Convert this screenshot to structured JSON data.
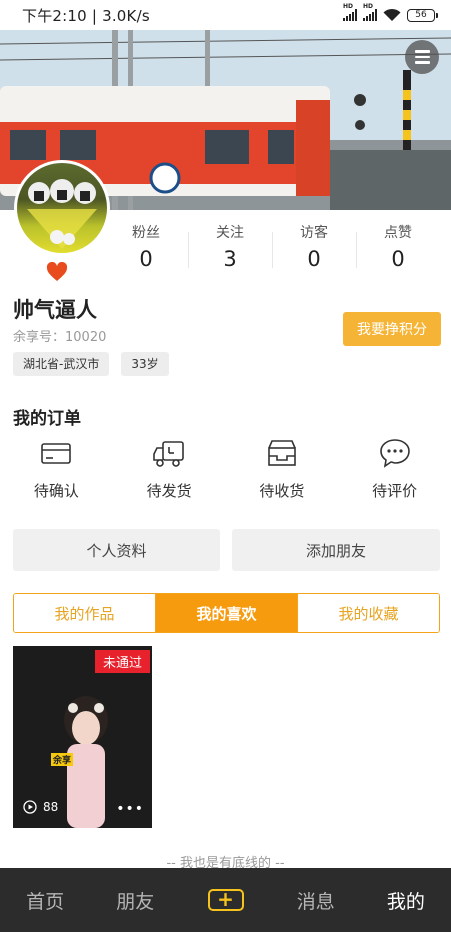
{
  "status_bar": {
    "time_speed": "下午2:10 | 3.0K/s",
    "battery": "56"
  },
  "user": {
    "name": "帅气逼人",
    "uid_label": "余享号：10020",
    "tags": [
      "湖北省-武汉市",
      "33岁"
    ],
    "earn_button": "我要挣积分"
  },
  "stats": [
    {
      "label": "粉丝",
      "value": "0"
    },
    {
      "label": "关注",
      "value": "3"
    },
    {
      "label": "访客",
      "value": "0"
    },
    {
      "label": "点赞",
      "value": "0"
    }
  ],
  "orders": {
    "title": "我的订单",
    "items": [
      {
        "label": "待确认",
        "icon": "card-icon"
      },
      {
        "label": "待发货",
        "icon": "truck-icon"
      },
      {
        "label": "待收货",
        "icon": "box-icon"
      },
      {
        "label": "待评价",
        "icon": "chat-bubble-icon"
      }
    ]
  },
  "actions": {
    "profile": "个人资料",
    "add_friend": "添加朋友"
  },
  "tabs": [
    {
      "label": "我的作品",
      "active": false
    },
    {
      "label": "我的喜欢",
      "active": true
    },
    {
      "label": "我的收藏",
      "active": false
    }
  ],
  "video": {
    "badge": "未通过",
    "play_count": "88",
    "brand": "余享"
  },
  "footer_note": "-- 我也是有底线的 --",
  "nav": {
    "home": "首页",
    "friends": "朋友",
    "messages": "消息",
    "me": "我的",
    "add": "+"
  },
  "colors": {
    "accent": "#f79b0e",
    "earn_button": "#f6b437",
    "nav_bg": "#2c2c2c",
    "badge": "#e8222c"
  }
}
